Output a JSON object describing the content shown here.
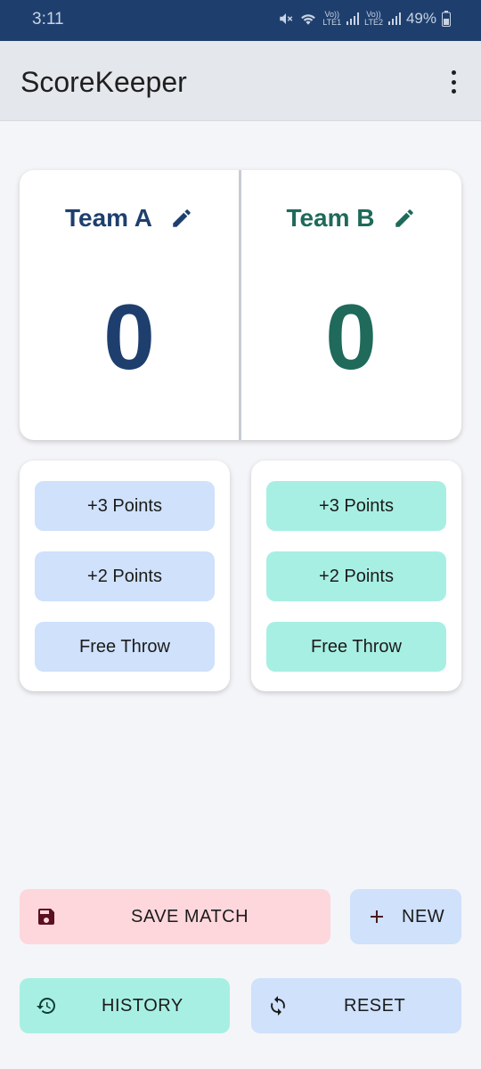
{
  "status_bar": {
    "time": "3:11",
    "sim1_label": "Vo))\nLTE1",
    "sim2_label": "Vo))\nLTE2",
    "battery": "49%"
  },
  "app_bar": {
    "title": "ScoreKeeper",
    "menu_icon": "more-vert-icon"
  },
  "teams": [
    {
      "name": "Team A",
      "score": "0",
      "color": "#1e3f6e"
    },
    {
      "name": "Team B",
      "score": "0",
      "color": "#1f6a5a"
    }
  ],
  "team_a_buttons": [
    "+3 Points",
    "+2 Points",
    "Free Throw"
  ],
  "team_b_buttons": [
    "+3 Points",
    "+2 Points",
    "Free Throw"
  ],
  "actions": {
    "save": {
      "label": "SAVE MATCH",
      "icon": "save-icon"
    },
    "new": {
      "label": "NEW",
      "icon": "plus-icon"
    },
    "history": {
      "label": "HISTORY",
      "icon": "history-icon"
    },
    "reset": {
      "label": "RESET",
      "icon": "refresh-icon"
    }
  },
  "colors": {
    "team_a_accent": "#cfe1fb",
    "team_b_accent": "#a8efe3",
    "save_bg": "#fdd7dc",
    "status_bar": "#1e3f6e"
  }
}
